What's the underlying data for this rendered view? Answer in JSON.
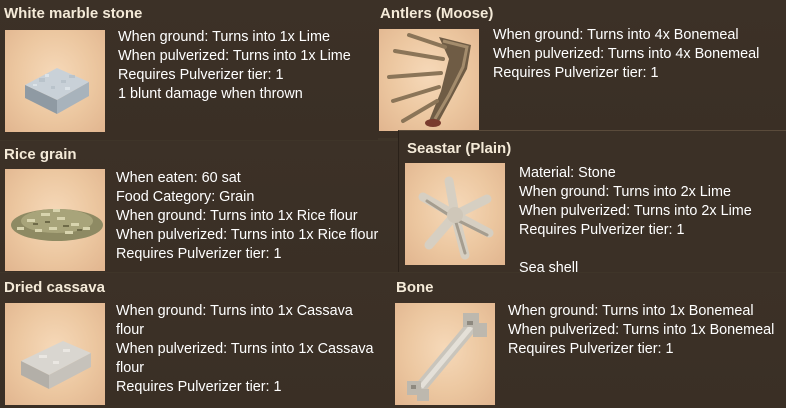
{
  "items": [
    {
      "key": "marble",
      "title": "White marble stone",
      "lines": [
        "When ground: Turns into 1x Lime",
        "When pulverized: Turns into 1x Lime",
        "Requires Pulverizer tier: 1",
        "1 blunt damage when thrown"
      ],
      "icon": "marble-block-icon"
    },
    {
      "key": "antlers",
      "title": "Antlers (Moose)",
      "lines": [
        "When ground: Turns into 4x Bonemeal",
        "When pulverized: Turns into 4x Bonemeal",
        "Requires Pulverizer tier: 1"
      ],
      "icon": "antlers-icon"
    },
    {
      "key": "rice",
      "title": "Rice grain",
      "lines": [
        "When eaten: 60 sat",
        "Food Category: Grain",
        "When ground: Turns into 1x Rice flour",
        "When pulverized: Turns into 1x Rice flour",
        "Requires Pulverizer tier: 1"
      ],
      "icon": "rice-pile-icon"
    },
    {
      "key": "seastar",
      "title": "Seastar (Plain)",
      "lines": [
        "Material: Stone",
        "When ground: Turns into 2x Lime",
        "When pulverized: Turns into 2x Lime",
        "Requires Pulverizer tier: 1",
        "",
        "Sea shell"
      ],
      "icon": "seastar-icon"
    },
    {
      "key": "cassava",
      "title": "Dried cassava",
      "lines": [
        "When ground: Turns into 1x Cassava",
        "flour",
        "When pulverized: Turns into 1x Cassava",
        "flour",
        "Requires Pulverizer tier: 1"
      ],
      "icon": "cassava-icon"
    },
    {
      "key": "bone",
      "title": "Bone",
      "lines": [
        "When ground: Turns into 1x Bonemeal",
        "When pulverized: Turns into 1x Bonemeal",
        "Requires Pulverizer tier: 1"
      ],
      "icon": "bone-icon"
    }
  ],
  "colors": {
    "panel_bg": "#3a2f25",
    "thumb_bg": "#f0cfaa",
    "title_text": "#f4ead8",
    "body_text": "#ffffff"
  }
}
